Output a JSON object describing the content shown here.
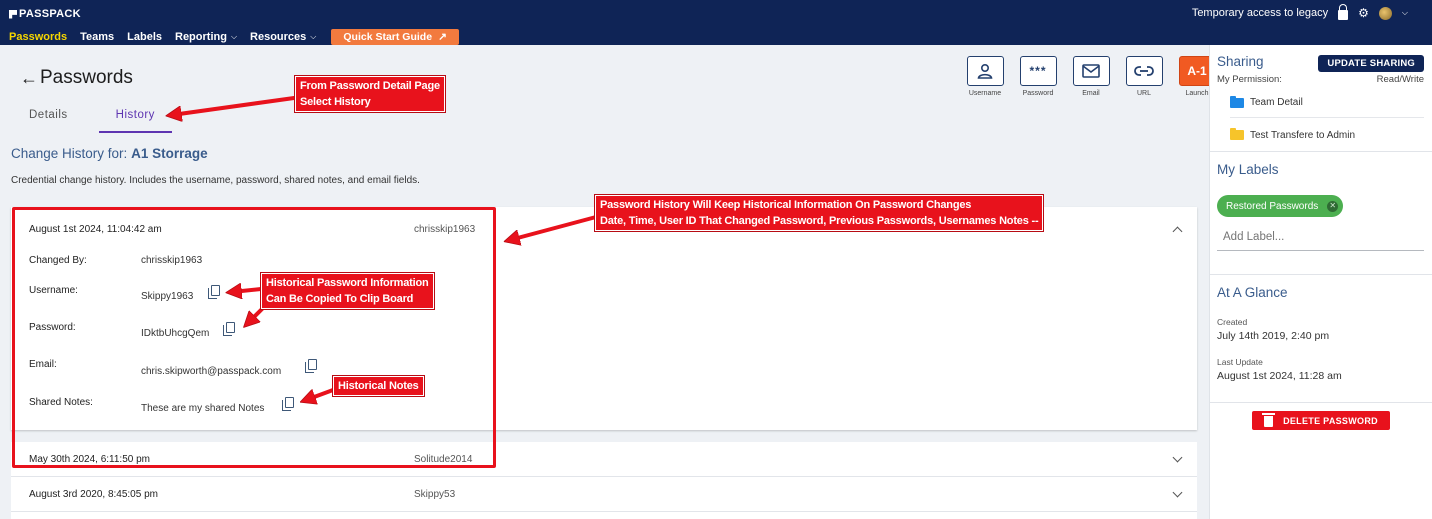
{
  "nav": {
    "logo": "PASSPACK",
    "items": [
      {
        "label": "Passwords"
      },
      {
        "label": "Teams"
      },
      {
        "label": "Labels"
      },
      {
        "label": "Reporting"
      },
      {
        "label": "Resources"
      }
    ],
    "quick_start": "Quick Start Guide",
    "temp_access": "Temporary access to legacy"
  },
  "page": {
    "title": "Passwords",
    "tabs": [
      "Details",
      "History"
    ],
    "active_tab": "History",
    "heading_prefix": "Change History for:",
    "heading_name": "A1 Storrage",
    "subtitle": "Credential change history. Includes the username, password, shared notes, and email fields."
  },
  "toolbar": [
    {
      "label": "Username",
      "icon": "person-icon"
    },
    {
      "label": "Password",
      "icon": "asterisk-icon",
      "glyph": "***"
    },
    {
      "label": "Email",
      "icon": "envelope-icon"
    },
    {
      "label": "URL",
      "icon": "link-icon"
    },
    {
      "label": "Launch",
      "icon": "launch-icon",
      "glyph": "A-1"
    }
  ],
  "history": {
    "expanded": {
      "date": "August 1st 2024, 11:04:42 am",
      "user": "chrisskip1963",
      "fields": {
        "changed_by_label": "Changed By:",
        "changed_by": "chrisskip1963",
        "username_label": "Username:",
        "username": "Skippy1963",
        "password_label": "Password:",
        "password": "IDktbUhcgQem",
        "email_label": "Email:",
        "email": "chris.skipworth@passpack.com",
        "notes_label": "Shared Notes:",
        "notes": "These are my shared Notes"
      }
    },
    "rows": [
      {
        "date": "May 30th 2024, 6:11:50 pm",
        "user": "Solitude2014"
      },
      {
        "date": "August 3rd 2020, 8:45:05 pm",
        "user": "Skippy53"
      }
    ]
  },
  "annotations": {
    "a1_line1": "From Password Detail Page",
    "a1_line2": "Select History",
    "a2_line1": "Password History Will Keep Historical Information On Password Changes",
    "a2_line2": "Date, Time, User ID That Changed Password, Previous Passwords, Usernames  Notes --",
    "a3_line1": "Historical Password Information",
    "a3_line2": "Can Be Copied To Clip Board",
    "a4": "Historical Notes"
  },
  "sidebar": {
    "sharing_title": "Sharing",
    "update_sharing": "UPDATE SHARING",
    "my_permission_label": "My Permission:",
    "my_permission_value": "Read/Write",
    "shares": [
      {
        "label": "Team Detail",
        "color": "#1e88e5"
      },
      {
        "label": "Test Transfere to Admin",
        "color": "#f6c42a"
      }
    ],
    "labels_title": "My Labels",
    "label_chip": "Restored Passwords",
    "add_label_placeholder": "Add Label...",
    "glance_title": "At A Glance",
    "created_label": "Created",
    "created_value": "July 14th 2019, 2:40 pm",
    "updated_label": "Last Update",
    "updated_value": "August 1st 2024, 11:28 am",
    "delete_label": "DELETE PASSWORD"
  },
  "colors": {
    "nav_bg": "#0f2456",
    "nav_active": "#f5d600",
    "quick_start_bg": "#f27a3e",
    "tab_active": "#5e35b1",
    "annotation_red": "#e8121c",
    "label_chip_green": "#4caf50"
  }
}
